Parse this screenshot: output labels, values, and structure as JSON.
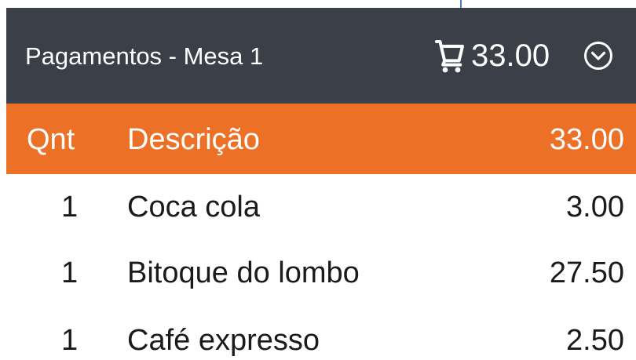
{
  "header": {
    "title": "Pagamentos - Mesa 1",
    "total": "33.00",
    "cart_icon": "shopping-cart-icon",
    "dropdown_icon": "chevron-down-circle-icon"
  },
  "table": {
    "columns": {
      "qty": "Qnt",
      "description": "Descrição",
      "total": "33.00"
    },
    "rows": [
      {
        "qty": "1",
        "description": "Coca cola",
        "price": "3.00"
      },
      {
        "qty": "1",
        "description": "Bitoque do lombo",
        "price": "27.50"
      },
      {
        "qty": "1",
        "description": "Café expresso",
        "price": "2.50"
      }
    ]
  },
  "colors": {
    "header_bg": "#3b3f47",
    "accent": "#ec7025",
    "arrow": "#4a7fc7"
  }
}
